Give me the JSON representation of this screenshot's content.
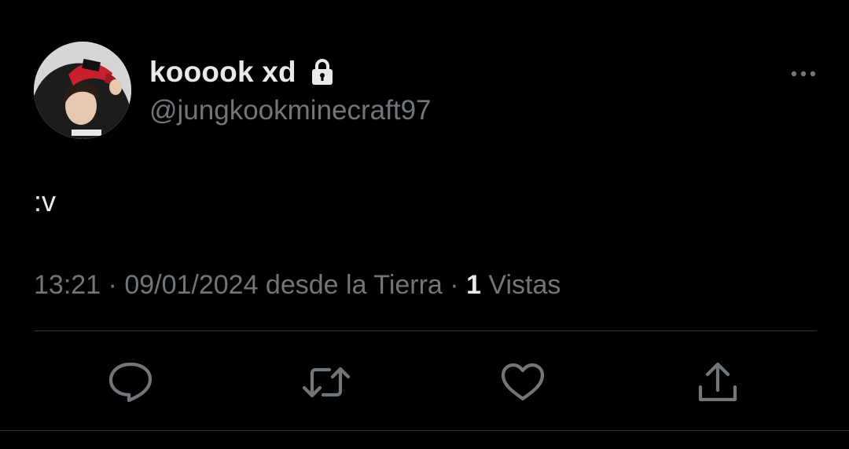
{
  "author": {
    "display_name": "kooook xd",
    "handle": "@jungkookminecraft97",
    "avatar_icon": "profile-photo",
    "protected_icon": "lock-icon"
  },
  "tweet": {
    "text": ":v"
  },
  "meta": {
    "time": "13:21",
    "separator": " · ",
    "date": "09/01/2024",
    "source": " desde la Tierra",
    "views_count": "1",
    "views_label": " Vistas"
  },
  "actions": [
    {
      "name": "reply",
      "icon": "comment-icon"
    },
    {
      "name": "retweet",
      "icon": "retweet-icon"
    },
    {
      "name": "like",
      "icon": "heart-icon"
    },
    {
      "name": "share",
      "icon": "share-icon"
    }
  ],
  "colors": {
    "background": "#000000",
    "primary_text": "#e7e9ea",
    "secondary_text": "#71767b",
    "divider": "#2f3336"
  }
}
